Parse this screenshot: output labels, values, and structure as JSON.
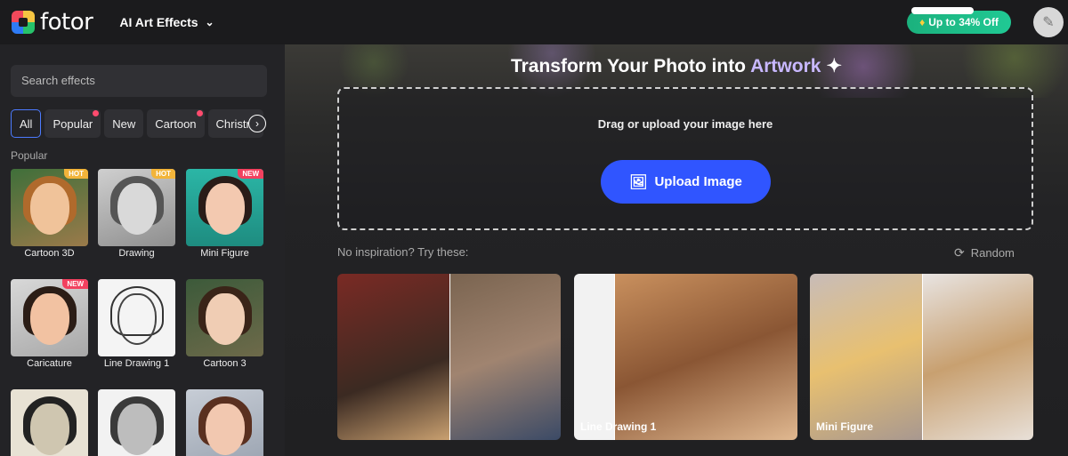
{
  "header": {
    "logo_text": "fotor",
    "menu_label": "AI Art Effects",
    "promo_label": "Up to 34% Off"
  },
  "sidebar": {
    "search_placeholder": "Search effects",
    "chips": [
      "All",
      "Popular",
      "New",
      "Cartoon",
      "Christm"
    ],
    "section_label": "Popular",
    "cards": [
      {
        "label": "Cartoon 3D",
        "badge": "HOT"
      },
      {
        "label": "Drawing",
        "badge": "HOT"
      },
      {
        "label": "Mini Figure",
        "badge": "NEW"
      },
      {
        "label": "Caricature",
        "badge": "NEW"
      },
      {
        "label": "Line Drawing 1",
        "badge": ""
      },
      {
        "label": "Cartoon 3",
        "badge": ""
      },
      {
        "label": "",
        "badge": ""
      },
      {
        "label": "",
        "badge": ""
      },
      {
        "label": "",
        "badge": ""
      }
    ]
  },
  "main": {
    "headline_prefix": "Transform Your Photo into ",
    "headline_accent": "Artwork",
    "drop_text": "Drag or upload your image here",
    "upload_label": "Upload Image",
    "inspire_text": "No inspiration? Try these:",
    "random_label": "Random",
    "samples": [
      {
        "label": ""
      },
      {
        "label": "Line Drawing 1"
      },
      {
        "label": "Mini Figure"
      }
    ]
  },
  "colors": {
    "accent_blue": "#3055ff",
    "promo_green": "#1bb17d",
    "badge_hot": "#f2b43a",
    "badge_new": "#f2415f"
  }
}
